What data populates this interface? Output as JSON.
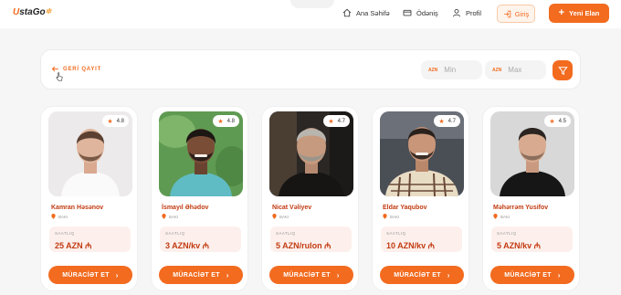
{
  "header": {
    "logo_u": "U",
    "logo_rest": "staGo",
    "nav": [
      {
        "label": "Ana Səhifə",
        "icon": "home-icon"
      },
      {
        "label": "Ödəniş",
        "icon": "card-icon"
      },
      {
        "label": "Profil",
        "icon": "user-icon"
      }
    ],
    "login_label": "Giriş",
    "new_listing_label": "Yeni Elan",
    "new_listing_plus": "+"
  },
  "filter": {
    "back_label": "GERİ QAYIT",
    "min": {
      "currency": "AZN",
      "placeholder": "Min"
    },
    "max": {
      "currency": "AZN",
      "placeholder": "Max"
    }
  },
  "cards": [
    {
      "name": "Kamran Həsənov",
      "city": "BAKI",
      "rating": "4.8",
      "price_label": "SAATLIQ",
      "price": "25 AZN ₼",
      "button": "MÜRACİƏT ET",
      "chevron": "›"
    },
    {
      "name": "İsmayıl Əhədov",
      "city": "BAKI",
      "rating": "4.8",
      "price_label": "SAATLIQ",
      "price": "3 AZN/kv ₼",
      "button": "MÜRACİƏT ET",
      "chevron": "›"
    },
    {
      "name": "Nicat Vəliyev",
      "city": "BAKI",
      "rating": "4.7",
      "price_label": "SAATLIQ",
      "price": "5 AZN/rulon ₼",
      "button": "MÜRACİƏT ET",
      "chevron": "›"
    },
    {
      "name": "Eldar Yaqubov",
      "city": "BAKI",
      "rating": "4.7",
      "price_label": "SAATLIQ",
      "price": "10 AZN/kv ₼",
      "button": "MÜRACİƏT ET",
      "chevron": "›"
    },
    {
      "name": "Məhərrəm Yusifov",
      "city": "BAKI",
      "rating": "4.5",
      "price_label": "SAATLIQ",
      "price": "5 AZN/kv ₼",
      "button": "MÜRACİƏT ET",
      "chevron": "›"
    }
  ],
  "rating_star": "★",
  "colors": {
    "accent": "#f26b1f",
    "name_red": "#c23b12",
    "price_bg": "#fdf0ec"
  }
}
